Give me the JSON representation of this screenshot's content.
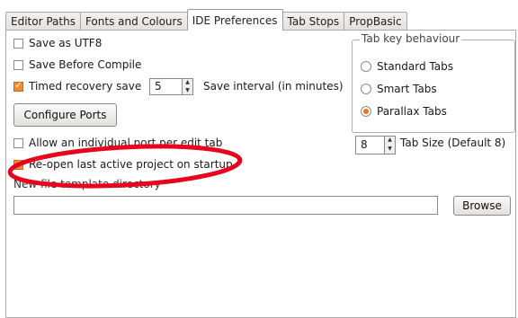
{
  "tabs": [
    {
      "label": "Editor Paths"
    },
    {
      "label": "Fonts and Colours"
    },
    {
      "label": "IDE Preferences"
    },
    {
      "label": "Tab Stops"
    },
    {
      "label": "PropBasic"
    }
  ],
  "active_tab": "IDE Preferences",
  "options": {
    "save_utf8": {
      "label": "Save as UTF8",
      "checked": false
    },
    "save_before_compile": {
      "label": "Save Before Compile",
      "checked": false
    },
    "timed_recovery": {
      "label": "Timed recovery save",
      "checked": true
    },
    "allow_port": {
      "label": "Allow an individual port per edit tab",
      "checked": false
    },
    "reopen_project": {
      "label": "Re-open last active project on startup",
      "checked": true
    }
  },
  "save_interval": {
    "value": "5",
    "label": "Save interval (in minutes)"
  },
  "configure_ports_label": "Configure Ports",
  "tab_key_group": {
    "title": "Tab key behaviour",
    "options": [
      {
        "label": "Standard Tabs",
        "selected": false
      },
      {
        "label": "Smart Tabs",
        "selected": false
      },
      {
        "label": "Parallax Tabs",
        "selected": true
      }
    ]
  },
  "tab_size": {
    "value": "8",
    "label": "Tab Size (Default 8)"
  },
  "template_dir": {
    "label": "New file template directory",
    "value": ""
  },
  "browse_label": "Browse",
  "colors": {
    "checked": "#f58b2c",
    "annotation": "#e8001c"
  }
}
